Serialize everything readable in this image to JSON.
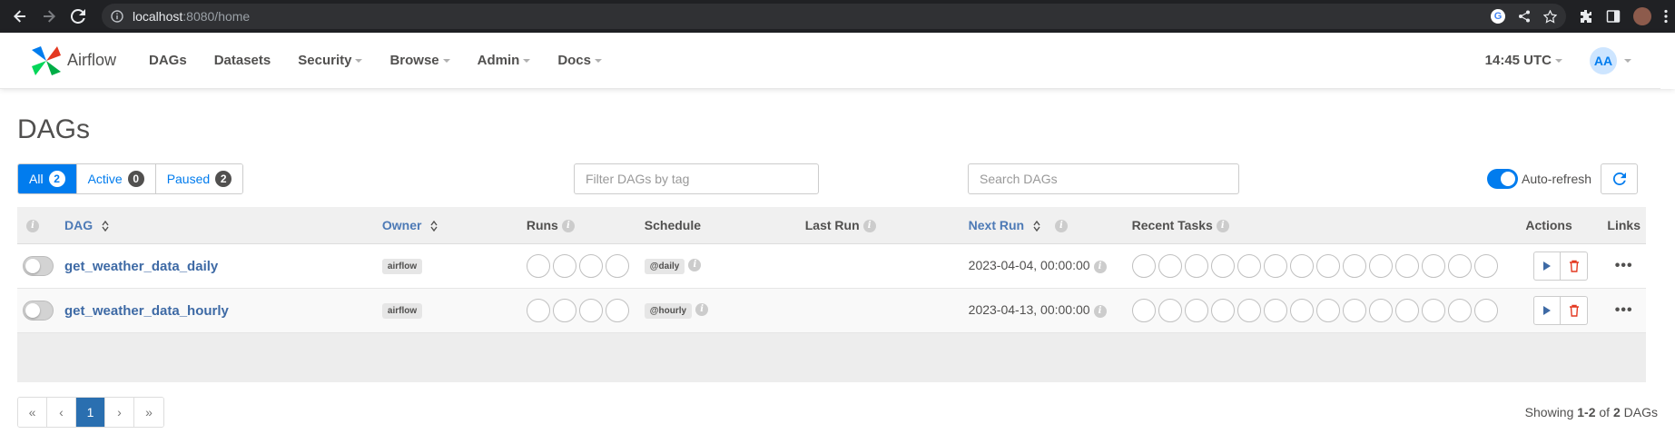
{
  "browser": {
    "url_host": "localhost",
    "url_rest": ":8080/home"
  },
  "navbar": {
    "brand": "Airflow",
    "items": [
      "DAGs",
      "Datasets",
      "Security",
      "Browse",
      "Admin",
      "Docs"
    ],
    "clock": "14:45 UTC",
    "avatar_initials": "AA"
  },
  "page": {
    "title": "DAGs"
  },
  "filters": {
    "all_label": "All",
    "all_count": "2",
    "active_label": "Active",
    "active_count": "0",
    "paused_label": "Paused",
    "paused_count": "2",
    "tag_placeholder": "Filter DAGs by tag",
    "search_placeholder": "Search DAGs",
    "autorefresh_label": "Auto-refresh"
  },
  "table": {
    "columns": {
      "dag": "DAG",
      "owner": "Owner",
      "runs": "Runs",
      "schedule": "Schedule",
      "last_run": "Last Run",
      "next_run": "Next Run",
      "recent_tasks": "Recent Tasks",
      "actions": "Actions",
      "links": "Links"
    },
    "rows": [
      {
        "dag_id": "get_weather_data_daily",
        "owner": "airflow",
        "schedule": "@daily",
        "last_run": "",
        "next_run": "2023-04-04, 00:00:00"
      },
      {
        "dag_id": "get_weather_data_hourly",
        "owner": "airflow",
        "schedule": "@hourly",
        "last_run": "",
        "next_run": "2023-04-13, 00:00:00"
      }
    ]
  },
  "pagination": {
    "first": "«",
    "prev": "‹",
    "current": "1",
    "next": "›",
    "last": "»",
    "showing_prefix": "Showing ",
    "showing_range": "1-2",
    "showing_of": " of ",
    "showing_total": "2",
    "showing_suffix": " DAGs"
  },
  "links_menu": "•••"
}
